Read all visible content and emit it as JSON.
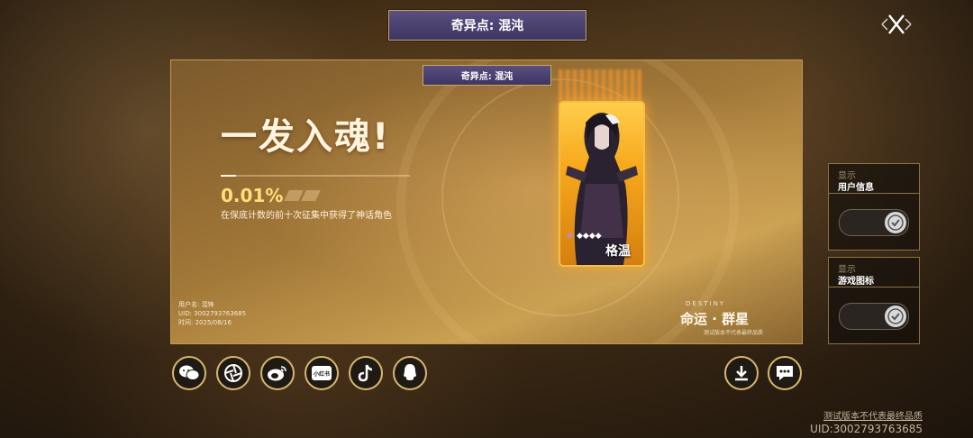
{
  "top_banner": {
    "title": "奇异点: 混沌"
  },
  "card": {
    "banner": "奇异点: 混沌",
    "headline": "一发入魂!",
    "progress": 0.08,
    "percent": "0.01%",
    "description": "在保底计数的前十次征集中获得了神话角色",
    "character": {
      "name": "格温",
      "stars": "◆◆◆◆",
      "rarity_icon": "spiral-icon"
    },
    "user_info": {
      "username": "用户名: 混锋",
      "uid": "UID: 3002793763685",
      "time": "时间: 2025/08/16"
    },
    "logo": {
      "top": "DESTINY",
      "main": "命运 · 群星",
      "note": "测试版本不代表最终品质"
    }
  },
  "side_panels": [
    {
      "hint": "显示",
      "title": "用户信息",
      "enabled": true
    },
    {
      "hint": "显示",
      "title": "游戏图标",
      "enabled": true
    }
  ],
  "share_icons": [
    "wechat-icon",
    "moments-icon",
    "weibo-icon",
    "xiaohongshu-icon",
    "tiktok-icon",
    "qq-icon"
  ],
  "share_label_xhs": "小红书",
  "actions": [
    "download-icon",
    "more-icon"
  ],
  "footer": {
    "note": "测试版本不代表最终品质",
    "uid": "UID:3002793763685"
  },
  "colors": {
    "accent_gold": "#d6b770",
    "banner_purple": "#4a4170",
    "percent_yellow": "#ffdf7a"
  }
}
